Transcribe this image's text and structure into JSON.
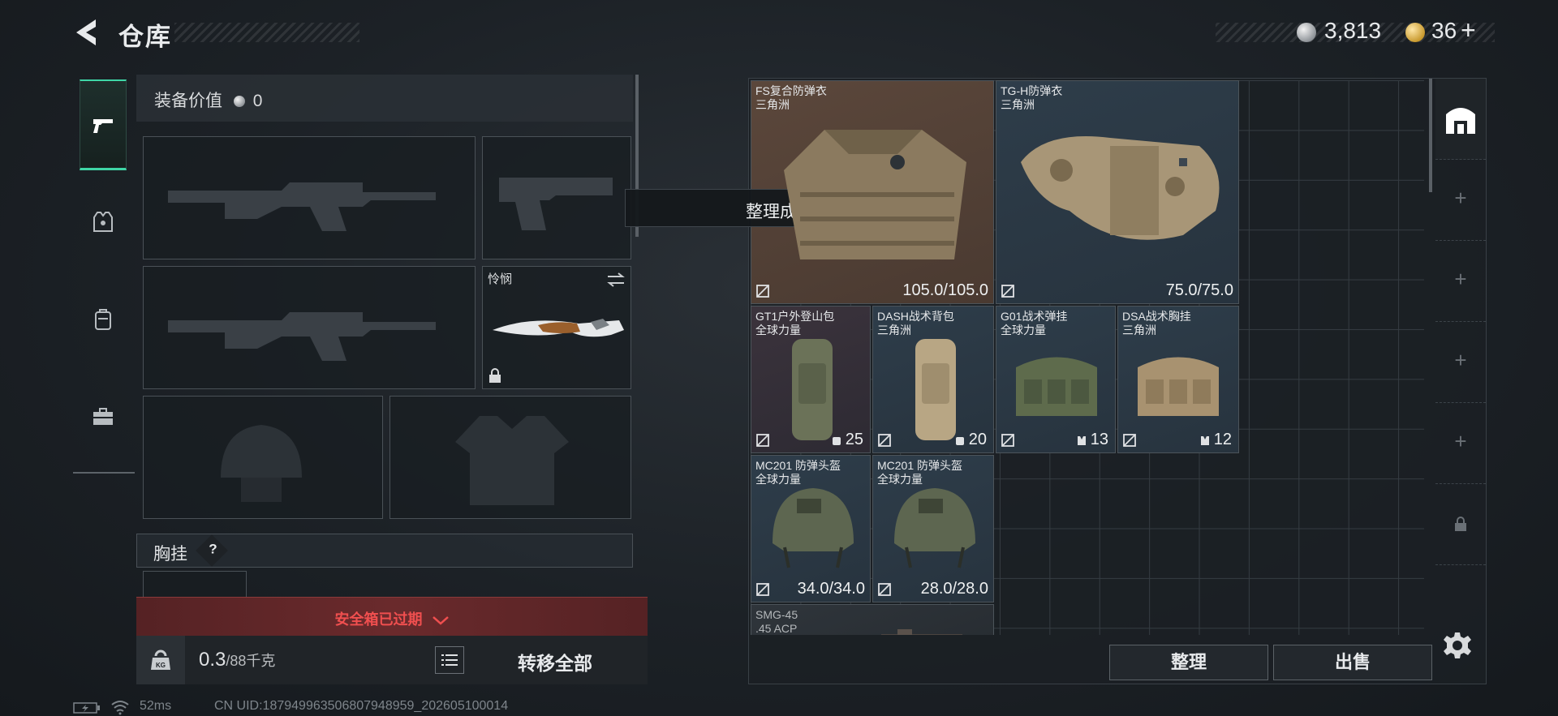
{
  "header": {
    "title": "仓库",
    "currency_silver": "3,813",
    "currency_gold": "36",
    "add_symbol": "+"
  },
  "nav": {
    "items": [
      {
        "name": "weapons",
        "icon": "pistol-icon",
        "active": true
      },
      {
        "name": "gear",
        "icon": "tactical-vest-icon",
        "active": false
      },
      {
        "name": "backpack",
        "icon": "backpack-icon",
        "active": false
      },
      {
        "name": "tools",
        "icon": "toolbox-icon",
        "active": false
      }
    ]
  },
  "equipment": {
    "value_label": "装备价值",
    "value_amount": "0",
    "melee_name": "怜悯",
    "chest_rig_label": "胸挂",
    "chest_rig_help": "?",
    "safe_box_status": "安全箱已过期",
    "weight_current": "0.3",
    "weight_max": "/88千克",
    "kg_label": "KG",
    "transfer_all": "转移全部"
  },
  "toast": "整理成功",
  "inventory": {
    "items": [
      {
        "name": "FS复合防弹衣",
        "source": "三角洲",
        "value": "105.0/105.0",
        "rarity": "brown"
      },
      {
        "name": "TG-H防弹衣",
        "source": "三角洲",
        "value": "75.0/75.0",
        "rarity": "blue"
      },
      {
        "name": "GT1户外登山包",
        "source": "全球力量",
        "value": "25",
        "rarity": "dark"
      },
      {
        "name": "DASH战术背包",
        "source": "三角洲",
        "value": "20",
        "rarity": "blue"
      },
      {
        "name": "G01战术弹挂",
        "source": "全球力量",
        "value": "13",
        "rarity": "blue"
      },
      {
        "name": "DSA战术胸挂",
        "source": "三角洲",
        "value": "12",
        "rarity": "blue"
      },
      {
        "name": "MC201 防弹头盔",
        "source": "全球力量",
        "value": "34.0/34.0",
        "rarity": "blue"
      },
      {
        "name": "MC201 防弹头盔",
        "source": "全球力量",
        "value": "28.0/28.0",
        "rarity": "blue"
      },
      {
        "name": "SMG-45",
        "source": ".45 ACP",
        "value": "",
        "rarity": "dark"
      }
    ],
    "sort_button": "整理",
    "sell_button": "出售"
  },
  "status": {
    "ping": "52ms",
    "uid": "CN UID:18794996350680794895​9_202605100014"
  },
  "colors": {
    "accent": "#3fd6a6",
    "expired": "#f04f4f",
    "brown_rarity": "#5b473b",
    "blue_rarity": "#2e3d4a"
  }
}
